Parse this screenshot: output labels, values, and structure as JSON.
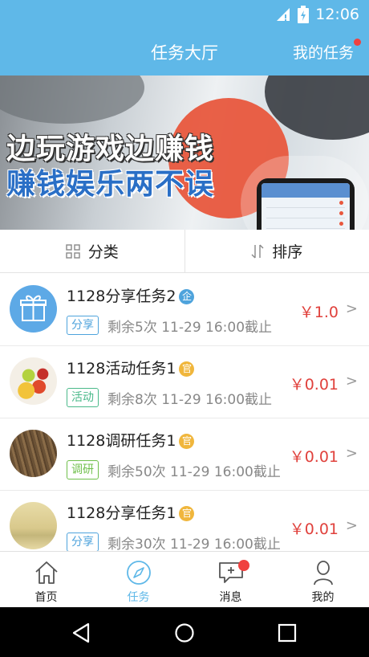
{
  "status_bar": {
    "time": "12:06"
  },
  "header": {
    "title": "任务大厅",
    "my_tasks": "我的任务"
  },
  "banner": {
    "line1": "边玩游戏边赚钱",
    "line2": "赚钱娱乐两不误"
  },
  "sort_bar": {
    "category_label": "分类",
    "sort_label": "排序"
  },
  "tasks": [
    {
      "title": "1128分享任务2",
      "badge": "企",
      "badge_color": "#4ea3dc",
      "tag": "分享",
      "tag_color": "#4ea3dc",
      "remaining": "剩余5次",
      "deadline": "11-29 16:00截止",
      "price": "￥1.0",
      "image": "gift-icon"
    },
    {
      "title": "1128活动任务1",
      "badge": "官",
      "badge_color": "#f0b63c",
      "tag": "活动",
      "tag_color": "#4ab98a",
      "remaining": "剩余8次",
      "deadline": "11-29 16:00截止",
      "price": "￥0.01",
      "image": "fruit-photo"
    },
    {
      "title": "1128调研任务1",
      "badge": "官",
      "badge_color": "#f0b63c",
      "tag": "调研",
      "tag_color": "#6fbf4a",
      "remaining": "剩余50次",
      "deadline": "11-29 16:00截止",
      "price": "￥0.01",
      "image": "grass-photo"
    },
    {
      "title": "1128分享任务1",
      "badge": "官",
      "badge_color": "#f0b63c",
      "tag": "分享",
      "tag_color": "#4ea3dc",
      "remaining": "剩余30次",
      "deadline": "11-29 16:00截止",
      "price": "￥0.01",
      "image": "sunset-photo"
    }
  ],
  "nav": [
    {
      "label": "首页",
      "icon": "home-icon"
    },
    {
      "label": "任务",
      "icon": "compass-icon",
      "active": true
    },
    {
      "label": "消息",
      "icon": "message-icon"
    },
    {
      "label": "我的",
      "icon": "user-icon"
    }
  ],
  "colors": {
    "primary": "#5fb8e8",
    "price": "#e0413c",
    "notification": "#f0413f"
  }
}
